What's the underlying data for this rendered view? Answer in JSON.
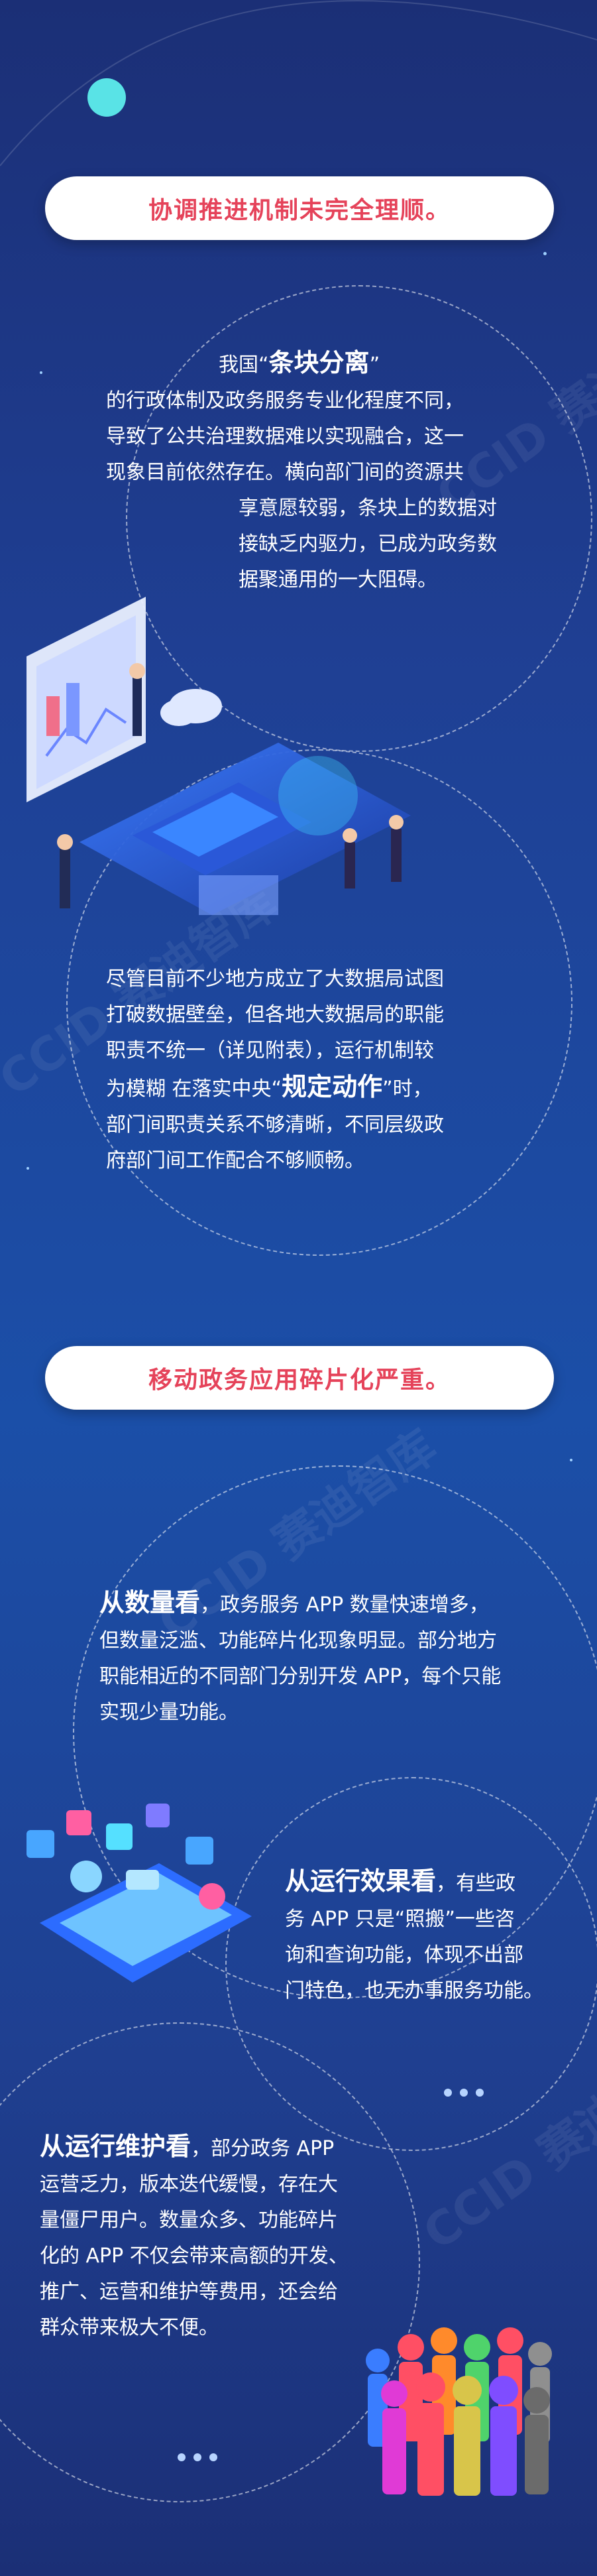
{
  "section1": {
    "title": "协调推进机制未完全理顺。",
    "p1": {
      "l1a": "我国“",
      "l1b": "条块分离",
      "l1c": "”",
      "l2": "的行政体制及政务服务专业化程度不同，",
      "l3": "导致了公共治理数据难以实现融合，这一",
      "l4": "现象目前依然存在。横向部门间的资源共",
      "l5": "享意愿较弱，条块上的数据对",
      "l6": "接缺乏内驱力，已成为政务数",
      "l7": "据聚通用的一大阻碍。"
    },
    "p2": {
      "l1": "尽管目前不少地方成立了大数据局试图",
      "l2": "打破数据壁垒，但各地大数据局的职能",
      "l3": "职责不统一（详见附表），运行机制较",
      "l4a": "为模糊 在落实中央“",
      "l4b": "规定动作",
      "l4c": "”时，",
      "l5": "部门间职责关系不够清晰，不同层级政",
      "l6": "府部门间工作配合不够顺畅。"
    }
  },
  "section2": {
    "title": "移动政务应用碎片化严重。",
    "p1": {
      "head": "从数量看",
      "l1": "，政务服务 APP 数量快速增多，",
      "l2": "但数量泛滥、功能碎片化现象明显。部分地方",
      "l3": "职能相近的不同部门分别开发 APP，每个只能",
      "l4": "实现少量功能。"
    },
    "p2": {
      "head": "从运行效果看",
      "l1": "，有些政",
      "l2": "务 APP 只是“照搬”一些咨",
      "l3": "询和查询功能，体现不出部",
      "l4": "门特色，也无办事服务功能。"
    },
    "p3": {
      "head": "从运行维护看",
      "l1": "，部分政务 APP",
      "l2": "运营乏力，版本迭代缓慢，存在大",
      "l3": "量僵尸用户。数量众多、功能碎片",
      "l4": "化的 APP 不仅会带来高额的开发、",
      "l5": "推广、运营和维护等费用，还会给",
      "l6": "群众带来极大不便。"
    }
  },
  "watermark": {
    "text": "CCID 赛迪智库"
  },
  "colors": {
    "accent": "#e5435a",
    "background": "#1c3a86",
    "pill": "#ffffff"
  }
}
